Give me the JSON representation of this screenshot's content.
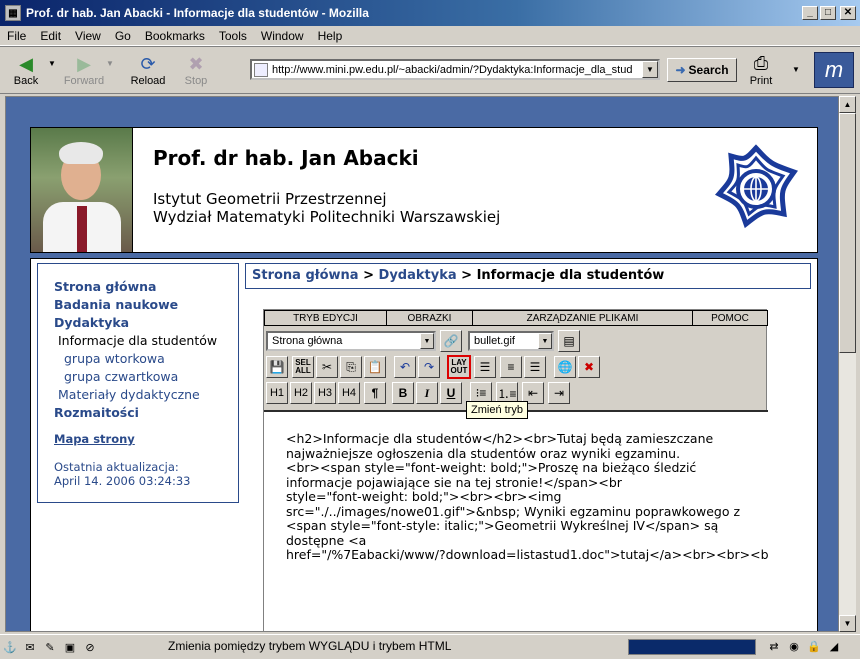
{
  "window": {
    "title": "Prof. dr hab. Jan Abacki - Informacje dla studentów - Mozilla"
  },
  "menu": [
    "File",
    "Edit",
    "View",
    "Go",
    "Bookmarks",
    "Tools",
    "Window",
    "Help"
  ],
  "nav": {
    "back": "Back",
    "forward": "Forward",
    "reload": "Reload",
    "stop": "Stop",
    "url": "http://www.mini.pw.edu.pl/~abacki/admin/?Dydaktyka:Informacje_dla_stud",
    "search": "Search",
    "print": "Print"
  },
  "header": {
    "name": "Prof. dr hab. Jan Abacki",
    "line1": "Istytut Geometrii Przestrzennej",
    "line2": "Wydział Matematyki Politechniki Warszawskiej"
  },
  "sidebar": {
    "home": "Strona główna",
    "research": "Badania naukowe",
    "didactics": "Dydaktyka",
    "students": "Informacje dla studentów",
    "group_tue": "grupa wtorkowa",
    "group_thu": "grupa czwartkowa",
    "materials": "Materiały dydaktyczne",
    "misc": "Rozmaitości",
    "sitemap": "Mapa strony",
    "updated_label": "Ostatnia aktualizacja:",
    "updated_date": "April 14. 2006 03:24:33"
  },
  "breadcrumb": {
    "home": "Strona główna",
    "sep1": " > ",
    "didactics": "Dydaktyka",
    "sep2": " > ",
    "current": "Informacje dla studentów"
  },
  "editor": {
    "tabs": [
      "TRYB EDYCJI",
      "OBRAZKI",
      "ZARZĄDZANIE PLIKAMI",
      "POMOC"
    ],
    "page_select": "Strona główna",
    "bullet_select": "bullet.gif",
    "headings": [
      "H1",
      "H2",
      "H3",
      "H4",
      "¶"
    ],
    "layout_label": "LAY OUT",
    "tooltip": "Zmień tryb",
    "content": "<h2>Informacje dla studentów</h2><br>Tutaj będą zamieszczane\nnajważniejsze ogłoszenia dla studentów oraz wyniki egzaminu.\n<br><span style=\"font-weight: bold;\">Proszę na bieżąco śledzić\ninformacje pojawiające sie na tej stronie!</span><br\nstyle=\"font-weight: bold;\"><br><br><img\nsrc=\"./../images/nowe01.gif\">&nbsp; Wyniki egzaminu poprawkowego z\n<span style=\"font-style: italic;\">Geometrii Wykreślnej IV</span> są\ndostępne <a\nhref=\"/%7Eabacki/www/?download=listastud1.doc\">tutaj</a><br><br><br>"
  },
  "status": {
    "text": "Zmienia pomiędzy trybem WYGLĄDU i trybem HTML"
  }
}
